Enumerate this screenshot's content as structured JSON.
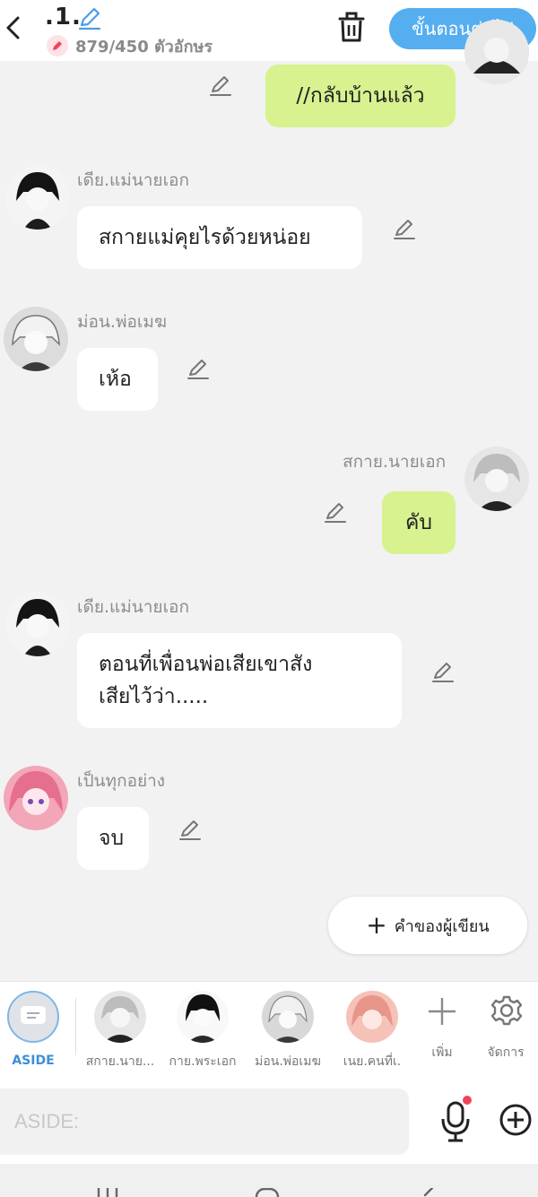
{
  "header": {
    "title": ".1.",
    "char_count": "879/450 ตัวอักษร",
    "next_label": "ขั้นตอนต่อไป"
  },
  "messages": [
    {
      "side": "right",
      "name": "",
      "text": "//กลับบ้านแล้ว"
    },
    {
      "side": "left",
      "name": "เดีย.แม่นายเอก",
      "text": "สกายแม่คุยไรด้วยหน่อย"
    },
    {
      "side": "left",
      "name": "ม่อน.พ่อเมฆ",
      "text": "เห้อ"
    },
    {
      "side": "right",
      "name": "สกาย.นายเอก",
      "text": "คับ"
    },
    {
      "side": "left",
      "name": "เดีย.แม่นายเอก",
      "text_line1": "ตอนที่เพื่อนพ่อเสียเขาสัง",
      "text_line2": "เสียไว้ว่า....."
    },
    {
      "side": "left",
      "name": "เป็นทุกอย่าง",
      "text": "จบ"
    }
  ],
  "author_words_label": "คำของผู้เขียน",
  "characters": {
    "aside_label": "ASIDE",
    "items": [
      {
        "label": "สกาย.นาย..."
      },
      {
        "label": "กาย.พระเอก"
      },
      {
        "label": "ม่อน.พ่อเมฆ"
      },
      {
        "label": "เนย.คนที่เ."
      }
    ],
    "add_label": "เพิ่ม",
    "manage_label": "จัดการ"
  },
  "input": {
    "placeholder": "ASIDE:"
  },
  "colors": {
    "accent": "#55aef0",
    "right_bubble": "#d7f28f",
    "left_bubble": "#ffffff",
    "background": "#f2f2f2"
  },
  "icons": [
    "back-arrow-icon",
    "pencil-icon",
    "trash-icon",
    "mic-icon",
    "plus-circle-icon",
    "gear-icon",
    "plus-icon",
    "chat-bubble-icon"
  ]
}
